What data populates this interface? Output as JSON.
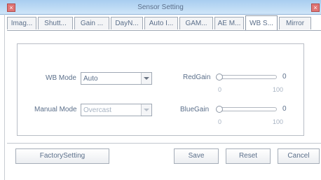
{
  "window": {
    "title": "Sensor Setting",
    "close_glyph": "×"
  },
  "tabs": [
    {
      "label": "Imag..."
    },
    {
      "label": "Shutt..."
    },
    {
      "label": "Gain ..."
    },
    {
      "label": "DayN..."
    },
    {
      "label": "Auto I..."
    },
    {
      "label": "GAM..."
    },
    {
      "label": "AE M..."
    },
    {
      "label": "WB S...",
      "active": true
    },
    {
      "label": "Mirror"
    }
  ],
  "wb": {
    "mode_label": "WB Mode",
    "mode_value": "Auto",
    "manual_label": "Manual Mode",
    "manual_value": "Overcast"
  },
  "red_gain": {
    "label": "RedGain",
    "value": "0",
    "min": "0",
    "max": "100",
    "fraction": 0
  },
  "blue_gain": {
    "label": "BlueGain",
    "value": "0",
    "min": "0",
    "max": "100",
    "fraction": 0
  },
  "buttons": {
    "factory": "FactorySetting",
    "save": "Save",
    "reset": "Reset",
    "cancel": "Cancel"
  },
  "icons": {
    "close": "close-icon",
    "dropdown": "chevron-down-icon",
    "slider_knob": "slider-knob"
  }
}
